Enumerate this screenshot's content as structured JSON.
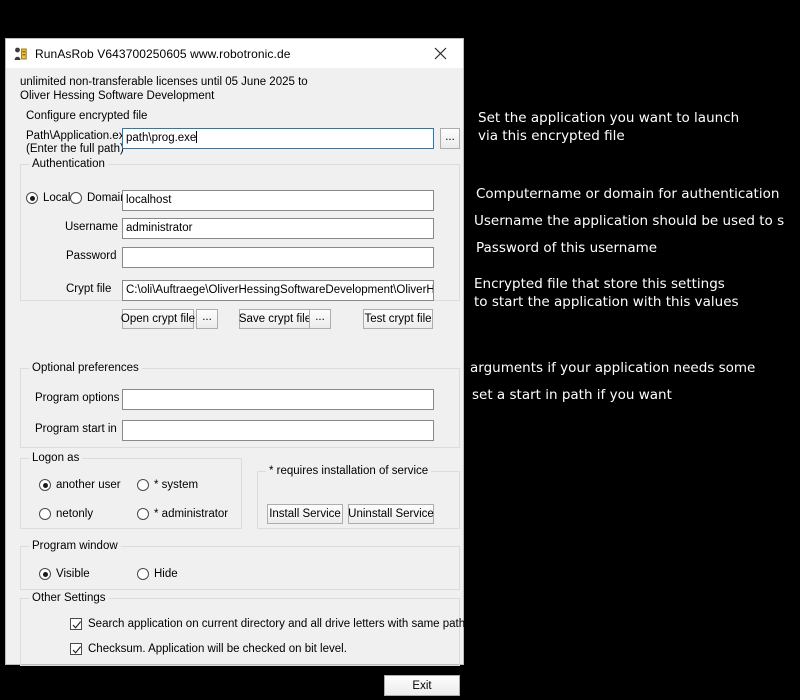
{
  "window": {
    "title": "RunAsRob V643700250605 www.robotronic.de",
    "title_icon": "runasrob-app-icon",
    "close_icon": "close-icon"
  },
  "license": {
    "line1": "unlimited non-transferable licenses until 05 June 2025 to",
    "line2": "Oliver Hessing Software Development"
  },
  "configure": {
    "section_label": "Configure encrypted file",
    "path_label_line1": "Path\\Application.exe",
    "path_label_line2": "(Enter the full path)",
    "path_value": "path\\prog.exe",
    "path_placeholder": "",
    "browse_label": "..."
  },
  "authentication": {
    "group_label": "Authentication",
    "local_label": "Local",
    "local_selected": true,
    "domain_label": "Domain",
    "domain_selected": false,
    "computer_value": "localhost",
    "computer_placeholder": "",
    "username_label": "Username",
    "username_value": "administrator",
    "username_placeholder": "",
    "password_label": "Password",
    "password_value": "",
    "password_placeholder": "",
    "crypt_label": "Crypt file",
    "crypt_value": "C:\\oli\\Auftraege\\OliverHessingSoftwareDevelopment\\OliverHessingSoftw",
    "crypt_placeholder": "",
    "open_crypt_label": "Open crypt file",
    "open_crypt_browse_label": "...",
    "save_crypt_label": "Save crypt file",
    "save_crypt_browse_label": "...",
    "test_crypt_label": "Test crypt file"
  },
  "optional": {
    "group_label": "Optional preferences",
    "program_options_label": "Program options",
    "program_options_value": "",
    "program_options_placeholder": "",
    "program_start_in_label": "Program start in",
    "program_start_in_value": "",
    "program_start_in_placeholder": ""
  },
  "logon": {
    "group_label": "Logon as",
    "options": [
      {
        "label": "another user",
        "selected": true
      },
      {
        "label": "* system",
        "selected": false
      },
      {
        "label": "netonly",
        "selected": false
      },
      {
        "label": "* administrator",
        "selected": false
      }
    ],
    "service_group_label": "* requires installation of service",
    "install_service_label": "Install Service",
    "uninstall_service_label": "Uninstall Service"
  },
  "program_window": {
    "group_label": "Program window",
    "visible_label": "Visible",
    "visible_selected": true,
    "hide_label": "Hide",
    "hide_selected": false
  },
  "other_settings": {
    "group_label": "Other Settings",
    "checkboxes": [
      {
        "label": "Search application on current directory and all drive letters with same path.",
        "checked": true
      },
      {
        "label": "Checksum. Application will be checked on bit level.",
        "checked": true
      }
    ]
  },
  "footer": {
    "exit_label": "Exit"
  },
  "annotations": [
    {
      "text": "Set the application you want to launch"
    },
    {
      "text": "via this encrypted file"
    },
    {
      "text": "Computername or domain for authentication"
    },
    {
      "text": "Username the application should be used to s"
    },
    {
      "text": "Password of this username"
    },
    {
      "text": "Encrypted file that store this settings"
    },
    {
      "text": "to start the application with this values"
    },
    {
      "text": "arguments if your application needs some"
    },
    {
      "text": "set a start in path if you want"
    }
  ],
  "colors": {
    "window_bg": "#f0f0f0",
    "desktop_bg": "#000000",
    "focus_border": "#2a7ab0",
    "annotation_text": "#ffffff"
  }
}
